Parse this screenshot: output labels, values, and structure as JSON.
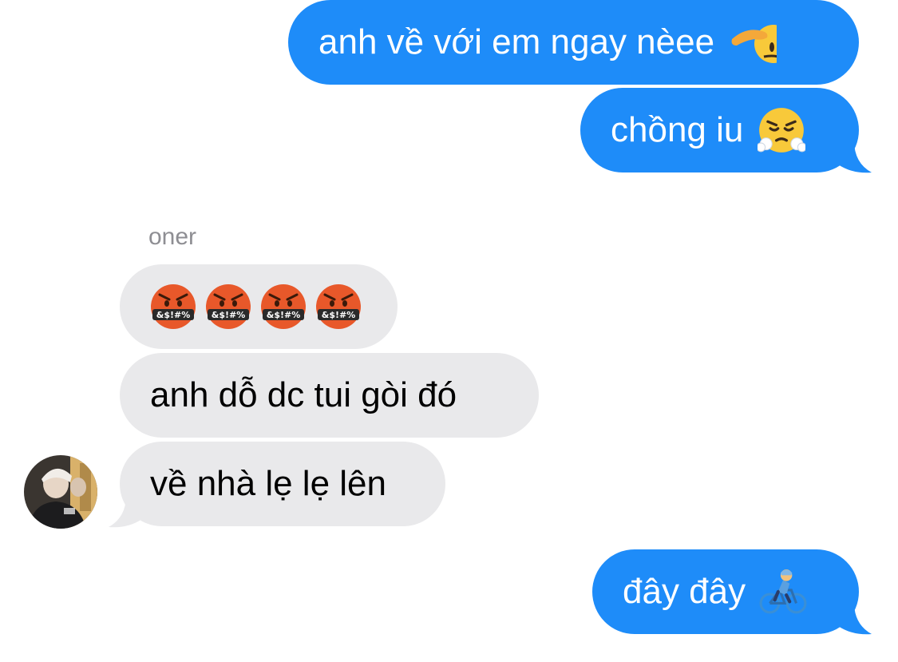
{
  "conversation": {
    "messages": [
      {
        "from": "me",
        "text": "anh về với em ngay nèee",
        "emoji": "saluting-face"
      },
      {
        "from": "me",
        "text": "chồng iu",
        "emoji": "face-with-steam-from-nose"
      },
      {
        "from": "them",
        "sender": "oner",
        "emojis": [
          "face-with-symbols-on-mouth",
          "face-with-symbols-on-mouth",
          "face-with-symbols-on-mouth",
          "face-with-symbols-on-mouth"
        ],
        "emoji_glyph_text": "&$!#%"
      },
      {
        "from": "them",
        "text": "anh dỗ dc tui gòi đó"
      },
      {
        "from": "them",
        "text": "về nhà lẹ lẹ lên"
      },
      {
        "from": "me",
        "text": "đây đây",
        "emoji": "person-biking"
      }
    ]
  },
  "colors": {
    "outgoing_bubble": "#1e8cf9",
    "incoming_bubble": "#e9e9eb",
    "sender_name": "#8e8e93"
  }
}
